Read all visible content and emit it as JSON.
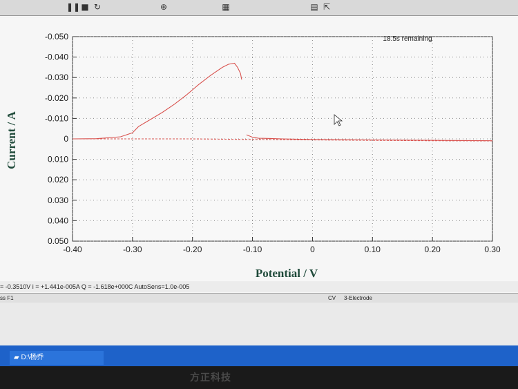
{
  "window": {
    "remaining_label": "18.5s remaining",
    "status_line": "= -0.3510V  i = +1.441e-005A  Q = -1.618e+000C  AutoSens=1.0e-005",
    "status_left": "ss F1",
    "technique": "CV",
    "electrode": "3-Electrode"
  },
  "toolbar": {
    "icons": [
      "pause-icon",
      "stop-icon",
      "redo-icon",
      "zoom-icon",
      "cursor-icon",
      "info-icon"
    ]
  },
  "taskbar": {
    "item_label": "D:\\杨乔"
  },
  "bezel": {
    "brand": "方正科技"
  },
  "chart_data": {
    "type": "line",
    "xlabel": "Potential / V",
    "ylabel": "Current / A",
    "xlim": [
      -0.4,
      0.3
    ],
    "ylim": [
      0.05,
      -0.05
    ],
    "x_ticks": [
      "-0.40",
      "-0.30",
      "-0.20",
      "-0.10",
      "0",
      "0.10",
      "0.20",
      "0.30"
    ],
    "y_ticks": [
      "-0.050",
      "-0.040",
      "-0.030",
      "-0.020",
      "-0.010",
      "0",
      "0.010",
      "0.020",
      "0.030",
      "0.040",
      "0.050"
    ],
    "line_color": "#d9534f",
    "series": [
      {
        "x": [
          -0.4,
          -0.36,
          -0.32,
          -0.3,
          -0.29,
          -0.27,
          -0.25,
          -0.23,
          -0.21,
          -0.19,
          -0.17,
          -0.15,
          -0.14,
          -0.13,
          -0.125
        ],
        "y": [
          0.0,
          -0.0001,
          -0.001,
          -0.003,
          -0.006,
          -0.0095,
          -0.013,
          -0.017,
          -0.0215,
          -0.0265,
          -0.031,
          -0.035,
          -0.0365,
          -0.037,
          -0.035
        ]
      },
      {
        "x": [
          -0.125,
          -0.12,
          -0.118
        ],
        "y": [
          -0.035,
          -0.032,
          -0.029
        ]
      },
      {
        "x": [
          -0.11,
          -0.1,
          -0.09,
          -0.07,
          -0.05,
          0.0,
          0.1,
          0.2,
          0.3
        ],
        "y": [
          -0.002,
          -0.0008,
          -0.0003,
          -0.0002,
          0.0,
          0.0003,
          0.0005,
          0.0007,
          0.0009
        ]
      },
      {
        "x": [
          -0.4,
          -0.3,
          -0.2,
          -0.1,
          0.0,
          0.1,
          0.2,
          0.3
        ],
        "y": [
          0.0,
          0.0,
          0.0,
          0.0003,
          0.0005,
          0.0007,
          0.0009,
          0.001
        ]
      }
    ]
  }
}
